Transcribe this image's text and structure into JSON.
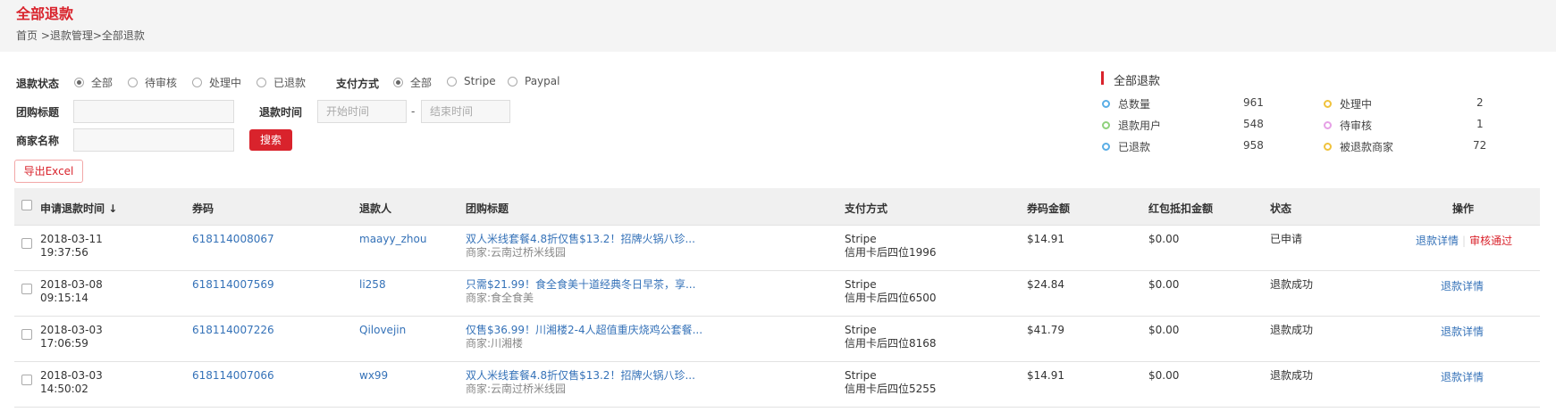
{
  "header": {
    "title": "全部退款",
    "breadcrumb": "首页 >退款管理>全部退款"
  },
  "filters": {
    "refund_status_label": "退款状态",
    "refund_status_options": [
      "全部",
      "待审核",
      "处理中",
      "已退款"
    ],
    "refund_status_selected": "全部",
    "payment_label": "支付方式",
    "payment_options": [
      "全部",
      "Stripe",
      "Paypal"
    ],
    "payment_selected": "全部",
    "group_title_label": "团购标题",
    "group_title_value": "",
    "refund_time_label": "退款时间",
    "start_placeholder": "开始时间",
    "end_placeholder": "结束时间",
    "dash": "-",
    "merchant_label": "商家名称",
    "merchant_value": "",
    "search_label": "搜索",
    "export_label": "导出Excel"
  },
  "stats": {
    "title": "全部退款",
    "items": [
      {
        "label": "总数量",
        "value": "961",
        "color": "#5aaee6"
      },
      {
        "label": "退款用户",
        "value": "548",
        "color": "#8fd17c"
      },
      {
        "label": "已退款",
        "value": "958",
        "color": "#5aaee6"
      },
      {
        "label": "处理中",
        "value": "2",
        "color": "#f0c23c"
      },
      {
        "label": "待审核",
        "value": "1",
        "color": "#e6a0e6"
      },
      {
        "label": "被退款商家",
        "value": "72",
        "color": "#f0c23c"
      }
    ]
  },
  "table": {
    "headers": {
      "time": "申请退款时间",
      "sort_icon": "↓",
      "code": "券码",
      "user": "退款人",
      "title": "团购标题",
      "payment": "支付方式",
      "amount": "券码金额",
      "redpack": "红包抵扣金额",
      "status": "状态",
      "ops": "操作"
    },
    "rows": [
      {
        "date": "2018-03-11",
        "time": "19:37:56",
        "code": "618114008067",
        "user": "maayy_zhou",
        "title": "双人米线套餐4.8折仅售$13.2！招牌火锅八珍...",
        "merchant": "商家:云南过桥米线园",
        "pay": "Stripe",
        "card": "信用卡后四位1996",
        "amount": "$14.91",
        "redpack": "$0.00",
        "status": "已申请",
        "op1": "退款详情",
        "op2": "审核通过"
      },
      {
        "date": "2018-03-08",
        "time": "09:15:14",
        "code": "618114007569",
        "user": "li258",
        "title": "只需$21.99！食全食美十道经典冬日早茶，享...",
        "merchant": "商家:食全食美",
        "pay": "Stripe",
        "card": "信用卡后四位6500",
        "amount": "$24.84",
        "redpack": "$0.00",
        "status": "退款成功",
        "op1": "退款详情",
        "op2": ""
      },
      {
        "date": "2018-03-03",
        "time": "17:06:59",
        "code": "618114007226",
        "user": "Qilovejin",
        "title": "仅售$36.99！川湘楼2-4人超值重庆烧鸡公套餐...",
        "merchant": "商家:川湘楼",
        "pay": "Stripe",
        "card": "信用卡后四位8168",
        "amount": "$41.79",
        "redpack": "$0.00",
        "status": "退款成功",
        "op1": "退款详情",
        "op2": ""
      },
      {
        "date": "2018-03-03",
        "time": "14:50:02",
        "code": "618114007066",
        "user": "wx99",
        "title": "双人米线套餐4.8折仅售$13.2！招牌火锅八珍...",
        "merchant": "商家:云南过桥米线园",
        "pay": "Stripe",
        "card": "信用卡后四位5255",
        "amount": "$14.91",
        "redpack": "$0.00",
        "status": "退款成功",
        "op1": "退款详情",
        "op2": ""
      }
    ]
  }
}
